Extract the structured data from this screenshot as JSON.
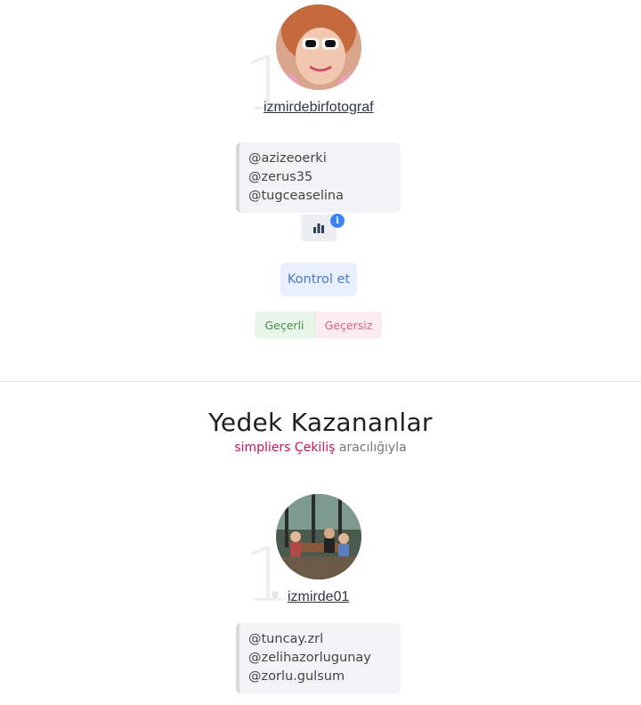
{
  "winners": [
    {
      "rank": "1",
      "username": "izmirdebirfotograf",
      "mentions": [
        "@azizeoerki @zerus35",
        "@tugceaselina"
      ],
      "stats_icon": "bar-chart-icon",
      "info_icon": "info-icon",
      "info_glyph": "i",
      "check_label": "Kontrol et",
      "valid_label": "Geçerli",
      "invalid_label": "Geçersiz"
    }
  ],
  "backups": {
    "title": "Yedek Kazananlar",
    "subtitle_brand": "simpliers Çekiliş",
    "subtitle_rest": " aracılığıyla",
    "items": [
      {
        "rank": "1.",
        "username": "izmirde01",
        "mentions": [
          "@tuncay.zrl",
          "@zelihazorlugunay",
          "@zorlu.gulsum"
        ]
      }
    ]
  },
  "colors": {
    "accent_blue": "#3b82f6",
    "valid_green": "#4b8b4f",
    "invalid_pink": "#d96380",
    "brand": "#c2185b"
  }
}
